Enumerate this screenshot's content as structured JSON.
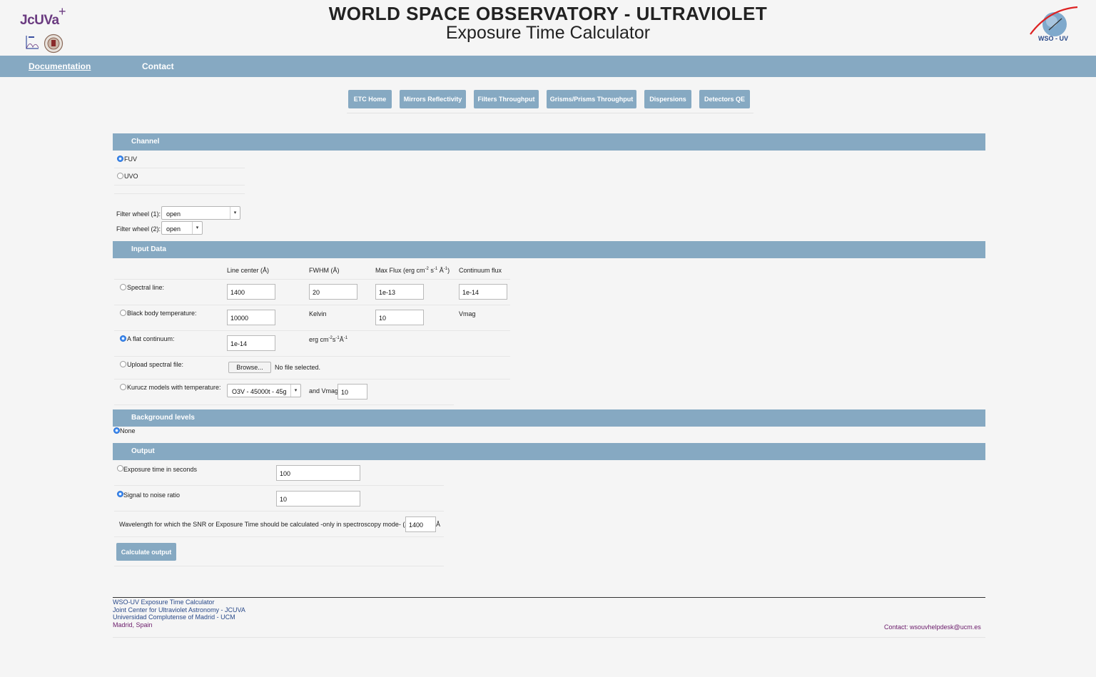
{
  "header": {
    "logo_left_text": "JcUVa",
    "title": "WORLD SPACE OBSERVATORY - ULTRAVIOLET",
    "subtitle": "Exposure Time Calculator",
    "logo_right_text": "WSO - UV"
  },
  "nav": {
    "documentation": "Documentation",
    "contact": "Contact"
  },
  "tabs": [
    "ETC Home",
    "Mirrors Reflectivity",
    "Filters Throughput",
    "Grisms/Prisms Throughput",
    "Dispersions",
    "Detectors QE"
  ],
  "channel": {
    "title": "Channel",
    "options": [
      "FUV",
      "UVO"
    ],
    "selected": "FUV",
    "filter1_label": "Filter wheel (1):",
    "filter1_value": "open",
    "filter2_label": "Filter wheel (2):",
    "filter2_value": "open"
  },
  "input": {
    "title": "Input Data",
    "headers": {
      "line_center": "Line center (Å)",
      "fwhm": "FWHM (Å)",
      "max_flux": "Max Flux (erg cm",
      "max_flux_s": " s",
      "max_flux_a": " Å",
      "max_flux_end": ")",
      "continuum": "Continuum flux",
      "exp_m2": "-2",
      "exp_m1": "-1"
    },
    "spectral_line": {
      "label": "Spectral line:",
      "center": "1400",
      "fwhm": "20",
      "max_flux": "1e-13",
      "continuum": "1e-14"
    },
    "black_body": {
      "label": "Black body temperature:",
      "temp": "10000",
      "unit": "Kelvin",
      "vmag": "10",
      "vmag_label": "Vmag"
    },
    "flat": {
      "label": "A flat continuum:",
      "value": "1e-14",
      "unit_a": "erg cm",
      "unit_b": "s",
      "unit_c": "Å",
      "exp_m2": "-2",
      "exp_m1": "-1"
    },
    "upload": {
      "label": "Upload spectral file:",
      "browse": "Browse...",
      "status": "No file selected."
    },
    "kurucz": {
      "label": "Kurucz models with temperature:",
      "model": "O3V - 45000t - 45g",
      "and_vmag": "and Vmag",
      "vmag": "10"
    },
    "selected": "A flat continuum:"
  },
  "background": {
    "title": "Background levels",
    "option": "None"
  },
  "output": {
    "title": "Output",
    "exp_label": "Exposure time in seconds",
    "exp_value": "100",
    "snr_label": "Signal to noise ratio",
    "snr_value": "10",
    "selected": "Signal to noise ratio",
    "wavelength_label": "Wavelength for which the SNR or Exposure Time should be calculated -only in spectroscopy mode- (λ):",
    "wavelength_value": "1400",
    "wavelength_unit": "Å",
    "calculate": "Calculate output"
  },
  "footer": {
    "line1": "WSO-UV Exposure Time Calculator",
    "line2": "Joint Center for Ultraviolet Astronomy - JCUVA",
    "line3": "Universidad Complutense of Madrid - UCM",
    "line4": "Madrid, Spain",
    "contact": "Contact: wsouvhelpdesk@ucm.es"
  },
  "colors": {
    "accent": "#86a9c2",
    "footer_text": "#6a1a6a",
    "footer_link": "#2a4a8a"
  }
}
